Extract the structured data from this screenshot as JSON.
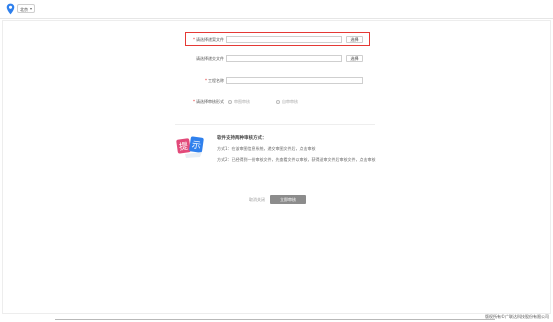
{
  "topbar": {
    "location_icon": "map-pin-icon",
    "city": "北京"
  },
  "form": {
    "field1": {
      "label": "请选择递案文件",
      "required": true,
      "value": "",
      "button": "选择"
    },
    "field2": {
      "label": "请选择递交文件",
      "required": false,
      "value": "",
      "button": "选择"
    },
    "field3": {
      "label": "工程名称",
      "required": true,
      "value": ""
    },
    "field4": {
      "label": "请选择审核形式",
      "required": true,
      "options": [
        "审图审核",
        "自审审核"
      ]
    }
  },
  "tip": {
    "icon": "tip-badge-icon",
    "icon_chars": [
      "提",
      "示"
    ],
    "title": "软件支持两种审核方式：",
    "line1": "方式1：在该审图信息系统，递交审图文件后，点击审核",
    "line2": "方式2：已经得到一份审核文件，先查看文件以审核，获得送审文件后审核文件，点击审核"
  },
  "actions": {
    "cancel": "取消关闭",
    "submit": "立即审核"
  },
  "footer": {
    "copyright": "版权所有©广联达科技股份有限公司"
  },
  "colors": {
    "highlight": "#e53935",
    "tip_blue": "#2f80ed",
    "tip_pink": "#e24a7a",
    "submit_bg": "#8c8c8c"
  }
}
